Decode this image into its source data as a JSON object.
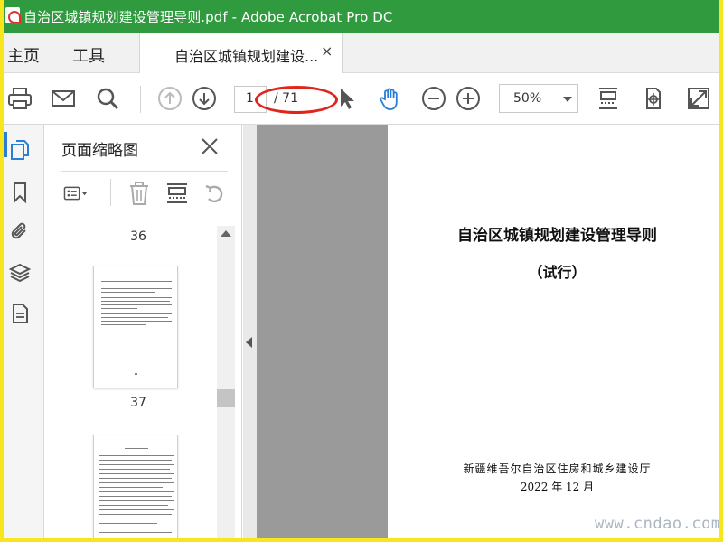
{
  "window": {
    "title": "自治区城镇规划建设管理导则.pdf - Adobe Acrobat Pro DC"
  },
  "nav": {
    "home_label": "主页",
    "tools_label": "工具",
    "doc_tab_label": "自治区城镇规划建设...",
    "close_glyph": "×"
  },
  "toolbar": {
    "current_page": "1",
    "page_total": "/ 71",
    "zoom": "50%"
  },
  "thumbnails": {
    "title": "页面缩略图",
    "pages": [
      {
        "label": "36"
      },
      {
        "label": "37"
      }
    ]
  },
  "document": {
    "title": "自治区城镇规划建设管理导则",
    "subtitle": "（试行）",
    "org": "新疆维吾尔自治区住房和城乡建设厅",
    "date": "2022 年 12 月"
  },
  "watermark": "www.cndao.com",
  "colors": {
    "titlebar": "#2f9a3e",
    "frame": "#f7e51d",
    "accent": "#2a7ed5",
    "annotation": "#e0251b"
  },
  "icons": [
    "print-icon",
    "mail-icon",
    "search-icon",
    "page-up-icon",
    "page-down-icon",
    "select-cursor-icon",
    "hand-icon",
    "zoom-out-icon",
    "zoom-in-icon",
    "fit-page-icon",
    "rotate-page-icon",
    "fullscreen-icon",
    "pages-icon",
    "bookmark-icon",
    "attachment-icon",
    "layers-icon",
    "document-icon",
    "close-icon",
    "thumbnail-options-icon",
    "trash-icon",
    "insert-page-icon",
    "undo-icon"
  ]
}
